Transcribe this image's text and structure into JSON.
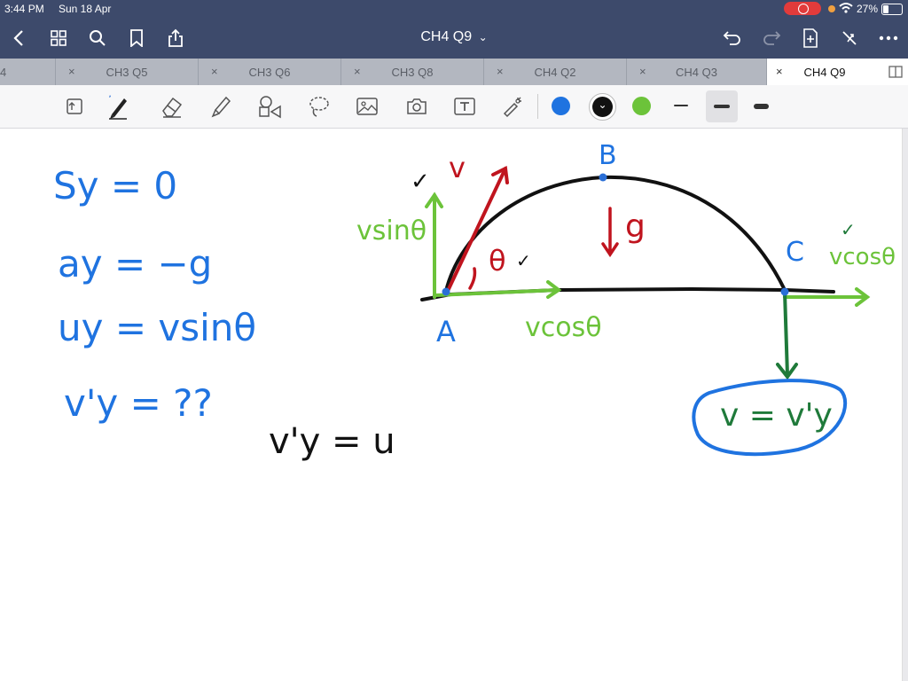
{
  "status_bar": {
    "time": "3:44 PM",
    "date": "Sun 18 Apr",
    "battery": "27%"
  },
  "nav": {
    "document_title": "CH4 Q9",
    "title_chevron": "⌄"
  },
  "tabs": [
    {
      "label": "4"
    },
    {
      "label": "CH3 Q5"
    },
    {
      "label": "CH3 Q6"
    },
    {
      "label": "CH3 Q8"
    },
    {
      "label": "CH4 Q2"
    },
    {
      "label": "CH4 Q3"
    },
    {
      "label": "CH4 Q9",
      "active": true
    }
  ],
  "tab_close": "×",
  "colors": {
    "bar": "#3d4a6b",
    "ink_blue": "#1f73e0",
    "ink_black": "#111111",
    "ink_green": "#6cc33a",
    "ink_red": "#c0141e",
    "ink_darkgreen": "#1f7a3a",
    "selected_point": "#2a6fd6"
  },
  "toolbar": {
    "icons": [
      "scroll-mode-icon",
      "pen-icon",
      "eraser-icon",
      "highlighter-icon",
      "shapes-icon",
      "lasso-icon",
      "image-icon",
      "camera-icon",
      "text-box-icon",
      "laser-pointer-icon"
    ],
    "swatches": [
      "blue",
      "black",
      "green"
    ],
    "selected_swatch_mark": "⌄"
  },
  "notes": {
    "left_eq1": "Sy = 0",
    "left_eq2": "ay = −g",
    "left_eq3": "uy = vsinθ",
    "left_eq4": "v'y = ??",
    "mid_eq": "v'y = u",
    "label_A": "A",
    "label_B": "B",
    "label_C": "C",
    "label_v": "v",
    "label_vsin": "vsinθ",
    "label_vcos_bottom": "vcosθ",
    "label_vcos_right": "vcosθ",
    "label_theta": "θ",
    "label_g": "g",
    "boxed_eq": "v = v'y",
    "checkmark": "✓"
  }
}
